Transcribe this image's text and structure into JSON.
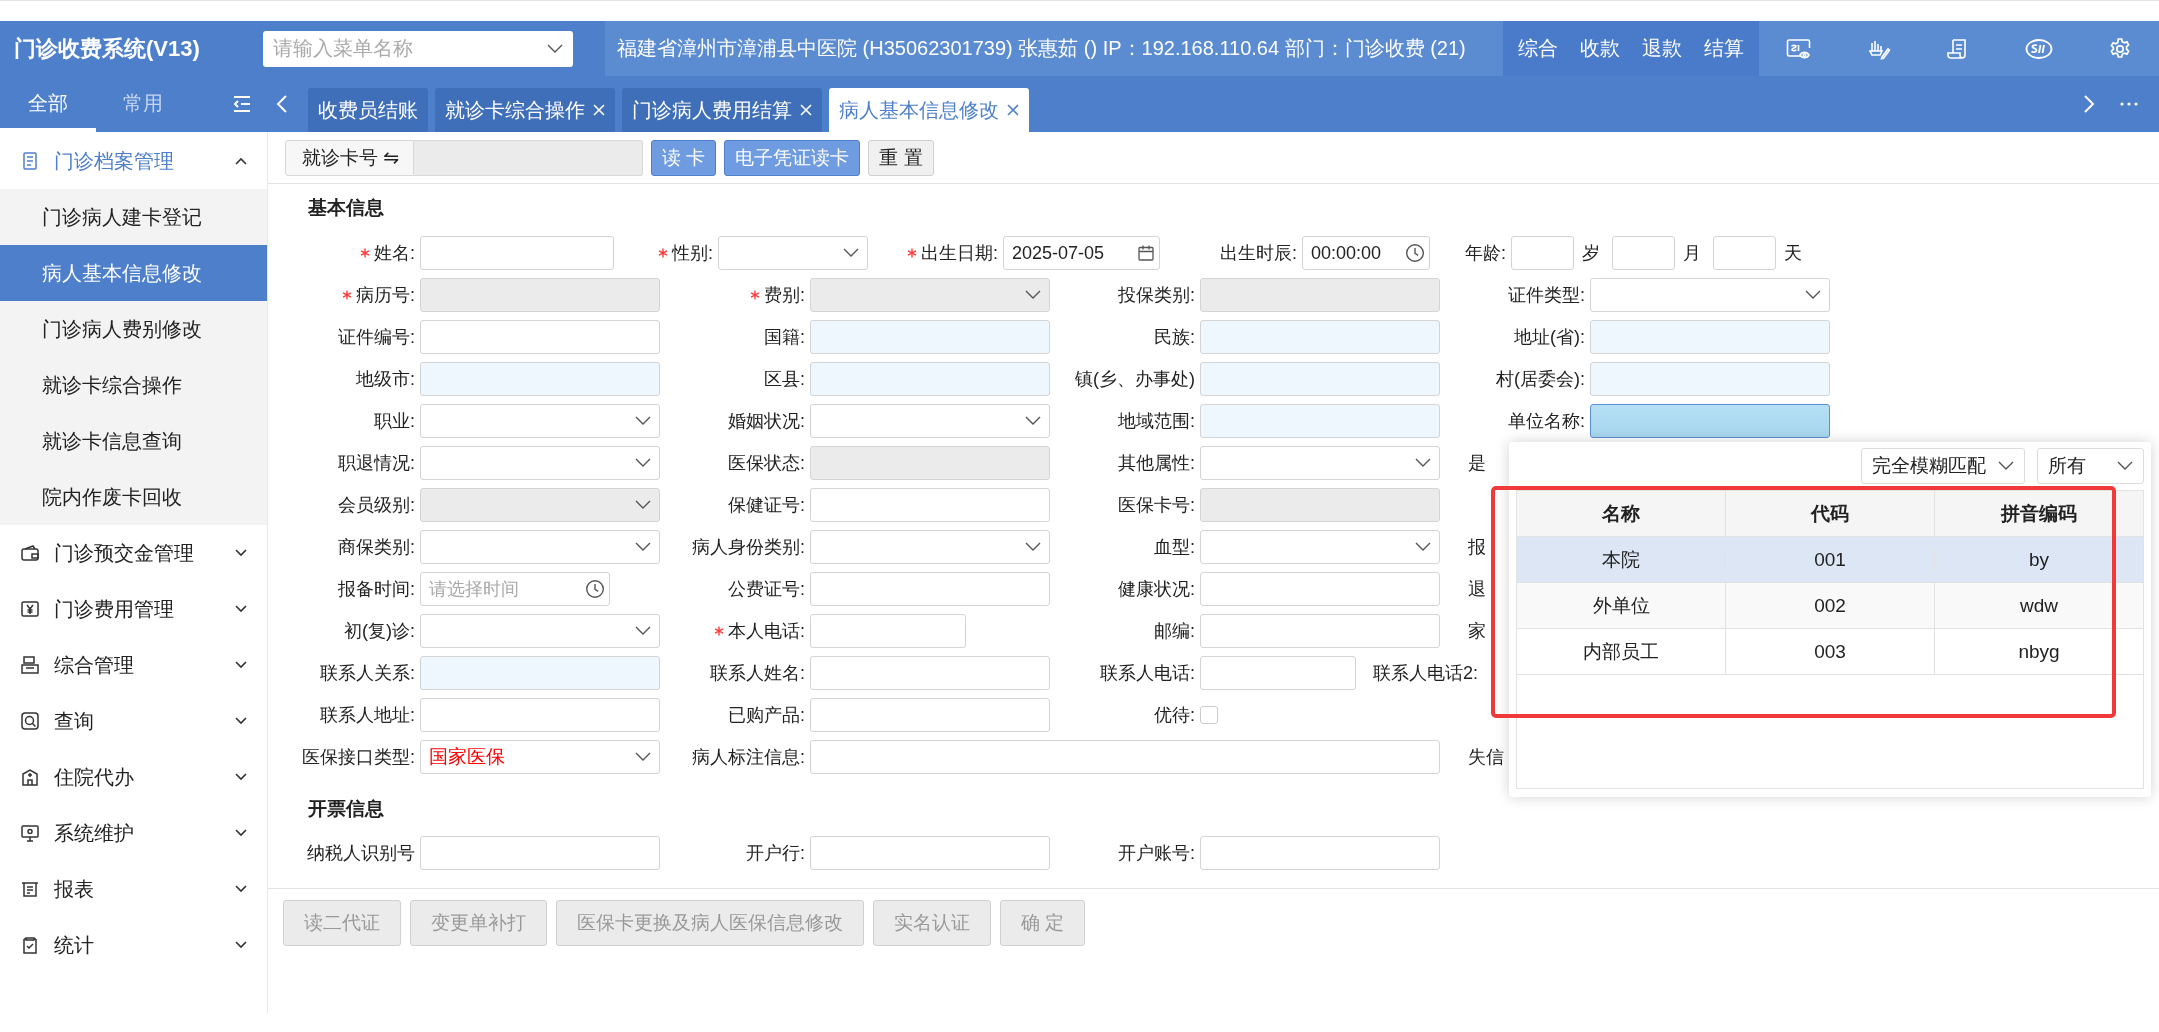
{
  "header": {
    "title": "门诊收费系统(V13)",
    "menu_search": {
      "placeholder": "请输入菜单名称"
    },
    "info": "福建省漳州市漳浦县中医院 (H35062301739) 张惠茹 () IP：192.168.110.64 部门：门诊收费 (21)",
    "nav": [
      "综合",
      "收款",
      "退款",
      "结算"
    ]
  },
  "sidebar": {
    "tabs": [
      {
        "label": "全部",
        "selected": true
      },
      {
        "label": "常用",
        "selected": false
      }
    ],
    "groups": [
      {
        "label": "门诊档案管理",
        "expanded": true,
        "children": [
          {
            "label": "门诊病人建卡登记",
            "selected": false
          },
          {
            "label": "病人基本信息修改",
            "selected": true
          },
          {
            "label": "门诊病人费别修改",
            "selected": false
          },
          {
            "label": "就诊卡综合操作",
            "selected": false
          },
          {
            "label": "就诊卡信息查询",
            "selected": false
          },
          {
            "label": "院内作废卡回收",
            "selected": false
          }
        ]
      },
      {
        "label": "门诊预交金管理",
        "expanded": false
      },
      {
        "label": "门诊费用管理",
        "expanded": false
      },
      {
        "label": "综合管理",
        "expanded": false
      },
      {
        "label": "查询",
        "expanded": false
      },
      {
        "label": "住院代办",
        "expanded": false
      },
      {
        "label": "系统维护",
        "expanded": false
      },
      {
        "label": "报表",
        "expanded": false
      },
      {
        "label": "统计",
        "expanded": false
      }
    ]
  },
  "tabs": [
    {
      "label": "收费员结账",
      "selected": false,
      "closable": false
    },
    {
      "label": "就诊卡综合操作",
      "selected": false,
      "closable": true
    },
    {
      "label": "门诊病人费用结算",
      "selected": false,
      "closable": true
    },
    {
      "label": "病人基本信息修改",
      "selected": true,
      "closable": true
    }
  ],
  "toolbar": {
    "card_label": "就诊卡号 ⇋",
    "buttons": [
      {
        "label": "读 卡",
        "kind": "primary"
      },
      {
        "label": "电子凭证读卡",
        "kind": "primary"
      },
      {
        "label": "重 置",
        "kind": "plain"
      }
    ]
  },
  "basic_info": {
    "title": "基本信息",
    "first_row": [
      {
        "label": "姓名:",
        "required": true,
        "kind": "input"
      },
      {
        "label": "性别:",
        "required": true,
        "kind": "select"
      },
      {
        "label": "出生日期:",
        "required": true,
        "kind": "date",
        "value": "2025-07-05"
      },
      {
        "label": "出生时辰:",
        "required": false,
        "kind": "time",
        "value": "00:00:00"
      },
      {
        "label": "年龄:",
        "required": false,
        "kind": "age",
        "units": [
          "岁",
          "月",
          "天"
        ]
      }
    ],
    "rows": [
      [
        {
          "label": "病历号:",
          "required": true,
          "kind": "readonly"
        },
        {
          "label": "费别:",
          "required": true,
          "kind": "select-disabled"
        },
        {
          "label": "投保类别:",
          "required": false,
          "kind": "readonly"
        },
        {
          "label": "证件类型:",
          "required": false,
          "kind": "select"
        }
      ],
      [
        {
          "label": "证件编号:",
          "required": false,
          "kind": "input"
        },
        {
          "label": "国籍:",
          "required": false,
          "kind": "lookup"
        },
        {
          "label": "民族:",
          "required": false,
          "kind": "lookup"
        },
        {
          "label": "地址(省):",
          "required": false,
          "kind": "lookup"
        }
      ],
      [
        {
          "label": "地级市:",
          "required": false,
          "kind": "lookup"
        },
        {
          "label": "区县:",
          "required": false,
          "kind": "lookup"
        },
        {
          "label": "镇(乡、办事处)",
          "required": false,
          "kind": "lookup"
        },
        {
          "label": "村(居委会):",
          "required": false,
          "kind": "lookup"
        }
      ],
      [
        {
          "label": "职业:",
          "required": false,
          "kind": "select"
        },
        {
          "label": "婚姻状况:",
          "required": false,
          "kind": "select"
        },
        {
          "label": "地域范围:",
          "required": false,
          "kind": "lookup"
        },
        {
          "label": "单位名称:",
          "required": false,
          "kind": "active"
        }
      ],
      [
        {
          "label": "职退情况:",
          "required": false,
          "kind": "select"
        },
        {
          "label": "医保状态:",
          "required": false,
          "kind": "readonly"
        },
        {
          "label": "其他属性:",
          "required": false,
          "kind": "select"
        },
        {
          "label": "是",
          "required": false,
          "kind": "cut"
        }
      ],
      [
        {
          "label": "会员级别:",
          "required": false,
          "kind": "select-disabled"
        },
        {
          "label": "保健证号:",
          "required": false,
          "kind": "input"
        },
        {
          "label": "医保卡号:",
          "required": false,
          "kind": "readonly"
        }
      ],
      [
        {
          "label": "商保类别:",
          "required": false,
          "kind": "select"
        },
        {
          "label": "病人身份类别:",
          "required": false,
          "kind": "select"
        },
        {
          "label": "血型:",
          "required": false,
          "kind": "select"
        },
        {
          "label": "报",
          "required": false,
          "kind": "cut"
        }
      ],
      [
        {
          "label": "报备时间:",
          "required": false,
          "kind": "time-short",
          "placeholder": "请选择时间"
        },
        {
          "label": "公费证号:",
          "required": false,
          "kind": "input"
        },
        {
          "label": "健康状况:",
          "required": false,
          "kind": "input"
        },
        {
          "label": "退",
          "required": false,
          "kind": "cut"
        }
      ],
      [
        {
          "label": "初(复)诊:",
          "required": false,
          "kind": "select"
        },
        {
          "label": "本人电话:",
          "required": true,
          "kind": "short"
        },
        {
          "label": "邮编:",
          "required": false,
          "kind": "input"
        },
        {
          "label": "家",
          "required": false,
          "kind": "cut"
        }
      ],
      [
        {
          "label": "联系人关系:",
          "required": false,
          "kind": "lookup"
        },
        {
          "label": "联系人姓名:",
          "required": false,
          "kind": "input"
        },
        {
          "label": "联系人电话:",
          "required": false,
          "kind": "short"
        },
        {
          "label": "联系人电话2:",
          "required": false,
          "kind": "cut"
        }
      ],
      [
        {
          "label": "联系人地址:",
          "required": false,
          "kind": "input"
        },
        {
          "label": "已购产品:",
          "required": false,
          "kind": "input"
        },
        {
          "label": "优待:",
          "required": false,
          "kind": "checkbox",
          "checked": false
        }
      ],
      [
        {
          "label": "医保接口类型:",
          "required": false,
          "kind": "select",
          "value": "国家医保",
          "color": "#ff0000"
        },
        {
          "label": "病人标注信息:",
          "required": false,
          "kind": "wide"
        },
        {
          "label": "失信",
          "required": false,
          "kind": "cut"
        }
      ]
    ]
  },
  "invoice_info": {
    "title": "开票信息",
    "rows": [
      [
        {
          "label": "纳税人识别号",
          "required": false,
          "kind": "input"
        },
        {
          "label": "开户行:",
          "required": false,
          "kind": "input"
        },
        {
          "label": "开户账号:",
          "required": false,
          "kind": "input"
        }
      ]
    ]
  },
  "footer_buttons": [
    {
      "label": "读二代证",
      "disabled": true
    },
    {
      "label": "变更单补打",
      "disabled": true
    },
    {
      "label": "医保卡更换及病人医保信息修改",
      "disabled": true
    },
    {
      "label": "实名认证",
      "disabled": true
    },
    {
      "label": "确 定",
      "disabled": true
    }
  ],
  "popup": {
    "filters": [
      {
        "value": "完全模糊匹配"
      },
      {
        "value": "所有"
      }
    ],
    "table": {
      "columns": [
        "名称",
        "代码",
        "拼音编码"
      ],
      "rows": [
        {
          "cells": [
            "本院",
            "001",
            "by"
          ],
          "selected": true
        },
        {
          "cells": [
            "外单位",
            "002",
            "wdw"
          ],
          "selected": false
        },
        {
          "cells": [
            "内部员工",
            "003",
            "nbyg"
          ],
          "selected": false
        }
      ]
    }
  }
}
